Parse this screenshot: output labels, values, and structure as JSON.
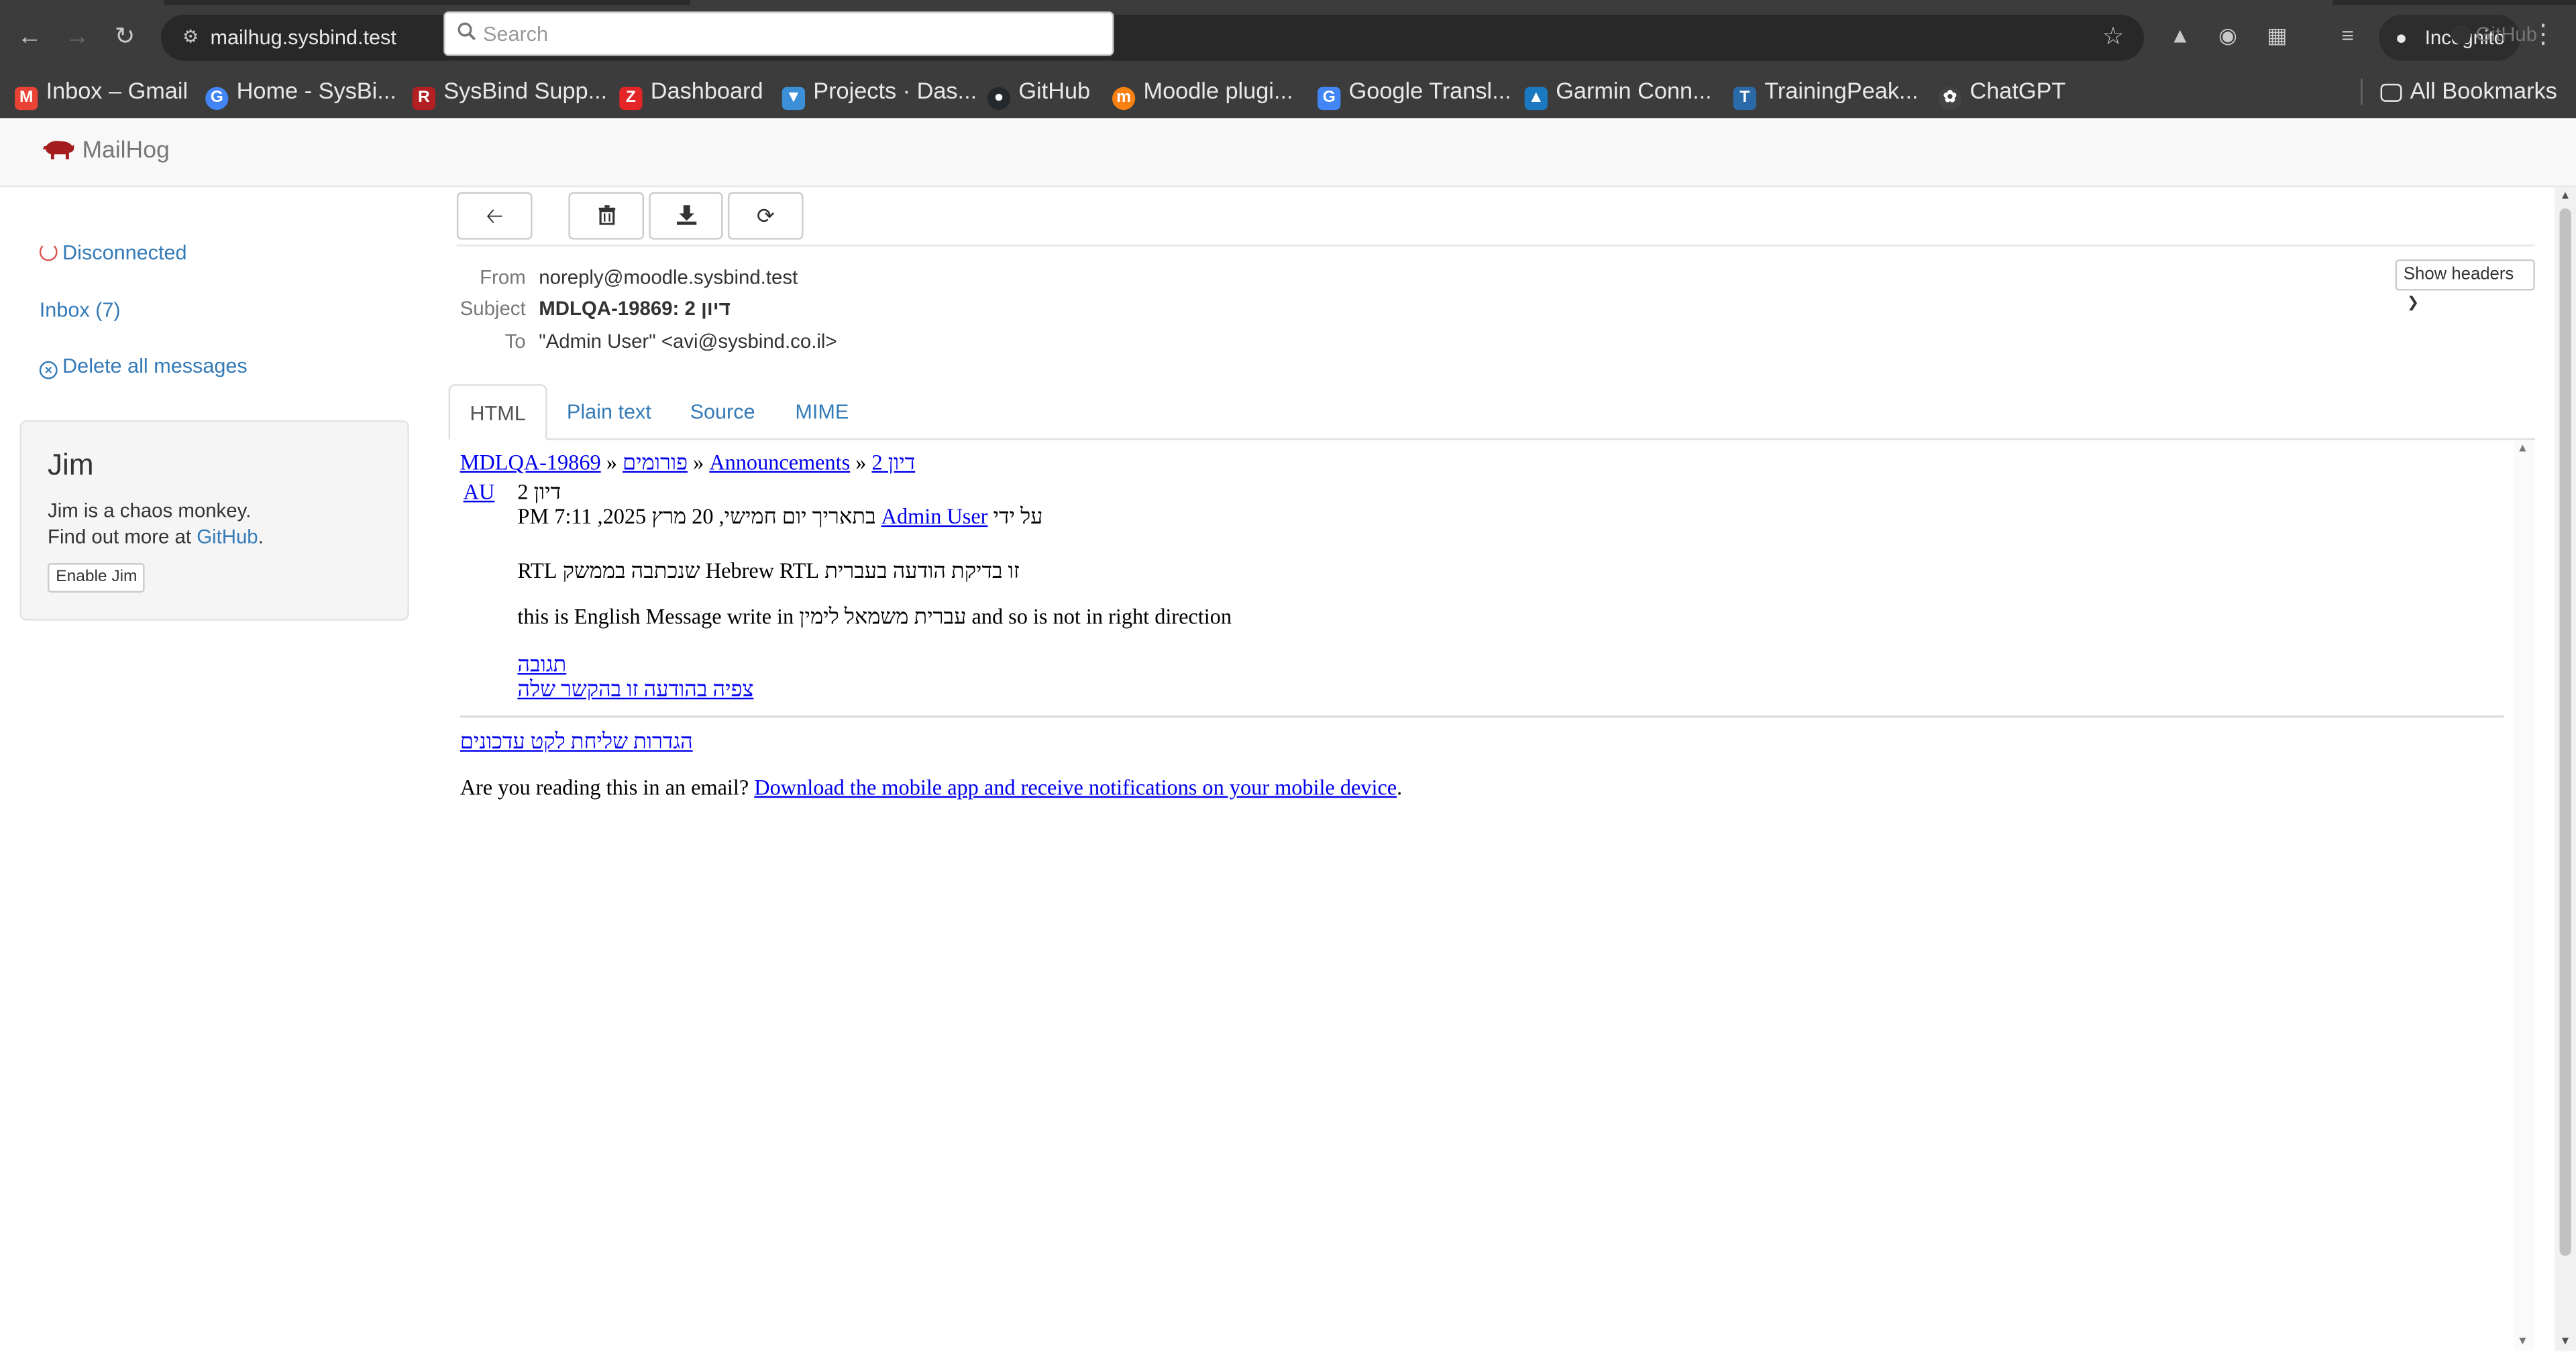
{
  "browser": {
    "url": "mailhug.sysbind.test",
    "incognito_label": "Incognito",
    "bookmarks": [
      {
        "label": "Inbox – Gmail",
        "icon": "gmail-icon",
        "color": "#ea4335"
      },
      {
        "label": "Home - SysBi...",
        "icon": "google-icon",
        "color": "#4285f4"
      },
      {
        "label": "SysBind Supp...",
        "icon": "redmine-icon",
        "color": "#b32024"
      },
      {
        "label": "Dashboard",
        "icon": "zoho-icon",
        "color": "#e42527"
      },
      {
        "label": "Projects · Das...",
        "icon": "gitlab-icon",
        "color": "#3d8fd8"
      },
      {
        "label": "GitHub",
        "icon": "github-icon",
        "color": "#24292e"
      },
      {
        "label": "Moodle plugi...",
        "icon": "moodle-icon",
        "color": "#f98012"
      },
      {
        "label": "Google Transl...",
        "icon": "translate-icon",
        "color": "#4285f4"
      },
      {
        "label": "Garmin Conn...",
        "icon": "garmin-icon",
        "color": "#1a79c0"
      },
      {
        "label": "TrainingPeak...",
        "icon": "trainingpeaks-icon",
        "color": "#2b6aa8"
      },
      {
        "label": "ChatGPT",
        "icon": "chatgpt-icon",
        "color": "#444444"
      }
    ],
    "all_bookmarks_label": "All Bookmarks"
  },
  "mailhog": {
    "logo_text": "MailHog",
    "search_placeholder": "Search",
    "github_label": "GitHub",
    "brand_color": "#a51c1c",
    "link_color": "#337ab7"
  },
  "sidebar": {
    "status_label": "Disconnected",
    "inbox_label": "Inbox (7)",
    "delete_all_label": "Delete all messages",
    "jim": {
      "title": "Jim",
      "description": "Jim is a chaos monkey.",
      "link_prefix": "Find out more at ",
      "link_text": "GitHub",
      "link_suffix": ".",
      "button_label": "Enable Jim"
    }
  },
  "message": {
    "headers": [
      {
        "label": "From",
        "value": "noreply@moodle.sysbind.test",
        "bold": false
      },
      {
        "label": "Subject",
        "value": "MDLQA-19869: דיון 2",
        "bold": true
      },
      {
        "label": "To",
        "value": "\"Admin User\" <avi@sysbind.co.il>",
        "bold": false
      }
    ],
    "show_headers_label": "Show headers",
    "tabs": [
      "HTML",
      "Plain text",
      "Source",
      "MIME"
    ],
    "active_tab": "HTML"
  },
  "email_body": {
    "breadcrumb": {
      "course": "MDLQA-19869",
      "sep": " » ",
      "forums": "פורומים",
      "announcements": "Announcements",
      "discussion": "דיון 2"
    },
    "avatar_initials": "AU",
    "post_subject": "דיון 2",
    "byline_prefix": "על ידי ",
    "author": "Admin User",
    "byline_date": " בתאריך יום חמישי, 20 מרץ 2025, 7:11 PM",
    "message_line_1": "זו בדיקת הודעה בעברית Hebrew RTL שנכתבה בממשק RTL",
    "message_line_2": "this is English Message write in עברית משמאל לימין and so is not in right direction",
    "reply_link": "תגובה",
    "context_link": "צפיה בהודעה זו בהקשר שלה",
    "digest_link": "הגדרות שליחת לקט עדכונים",
    "footer_prefix": "Are you reading this in an email? ",
    "footer_link": "Download the mobile app and receive notifications on your mobile device",
    "footer_suffix": "."
  }
}
